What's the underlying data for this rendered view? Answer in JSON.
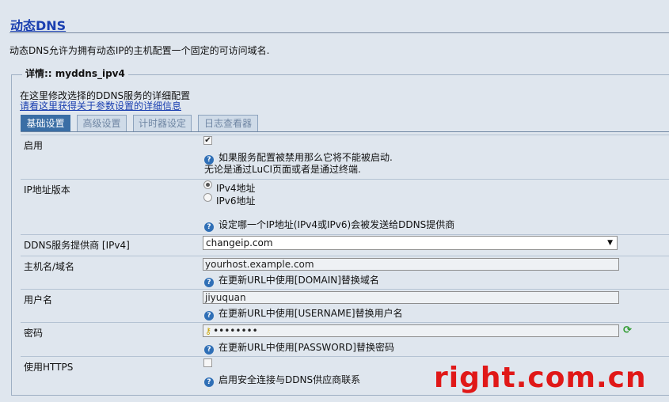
{
  "page": {
    "title": "动态DNS",
    "description": "动态DNS允许为拥有动态IP的主机配置一个固定的可访问域名."
  },
  "section": {
    "legend": "详情:: myddns_ipv4",
    "description": "在这里修改选择的DDNS服务的详细配置",
    "help_link": "请看这里获得关于参数设置的详细信息"
  },
  "tabs": [
    {
      "label": "基础设置",
      "active": true
    },
    {
      "label": "高级设置",
      "active": false
    },
    {
      "label": "计时器设定",
      "active": false
    },
    {
      "label": "日志查看器",
      "active": false
    }
  ],
  "fields": {
    "enable": {
      "label": "启用",
      "checked": true,
      "help_line1": "如果服务配置被禁用那么它将不能被启动.",
      "help_line2": "无论是通过LuCI页面或者是通过终端."
    },
    "ip_version": {
      "label": "IP地址版本",
      "options": [
        "IPv4地址",
        "IPv6地址"
      ],
      "selected": "IPv4地址",
      "help": "设定哪一个IP地址(IPv4或IPv6)会被发送给DDNS提供商"
    },
    "provider": {
      "label": "DDNS服务提供商 [IPv4]",
      "value": "changeip.com"
    },
    "hostname": {
      "label": "主机名/域名",
      "value": "yourhost.example.com",
      "help": "在更新URL中使用[DOMAIN]替换域名"
    },
    "username": {
      "label": "用户名",
      "value": "jiyuquan",
      "help": "在更新URL中使用[USERNAME]替换用户名"
    },
    "password": {
      "label": "密码",
      "value": "••••••••",
      "help": "在更新URL中使用[PASSWORD]替换密码"
    },
    "https": {
      "label": "使用HTTPS",
      "checked": false,
      "help": "启用安全连接与DDNS供应商联系"
    }
  },
  "watermark": "right.com.cn",
  "icons": {
    "help": "help-icon",
    "key": "key-icon",
    "refresh": "refresh-icon",
    "dropdown": "chevron-down-icon"
  },
  "colors": {
    "background": "#dfe6ee",
    "link": "#1a3fb0",
    "active_tab": "#3a6ea5",
    "watermark": "#e01818"
  }
}
